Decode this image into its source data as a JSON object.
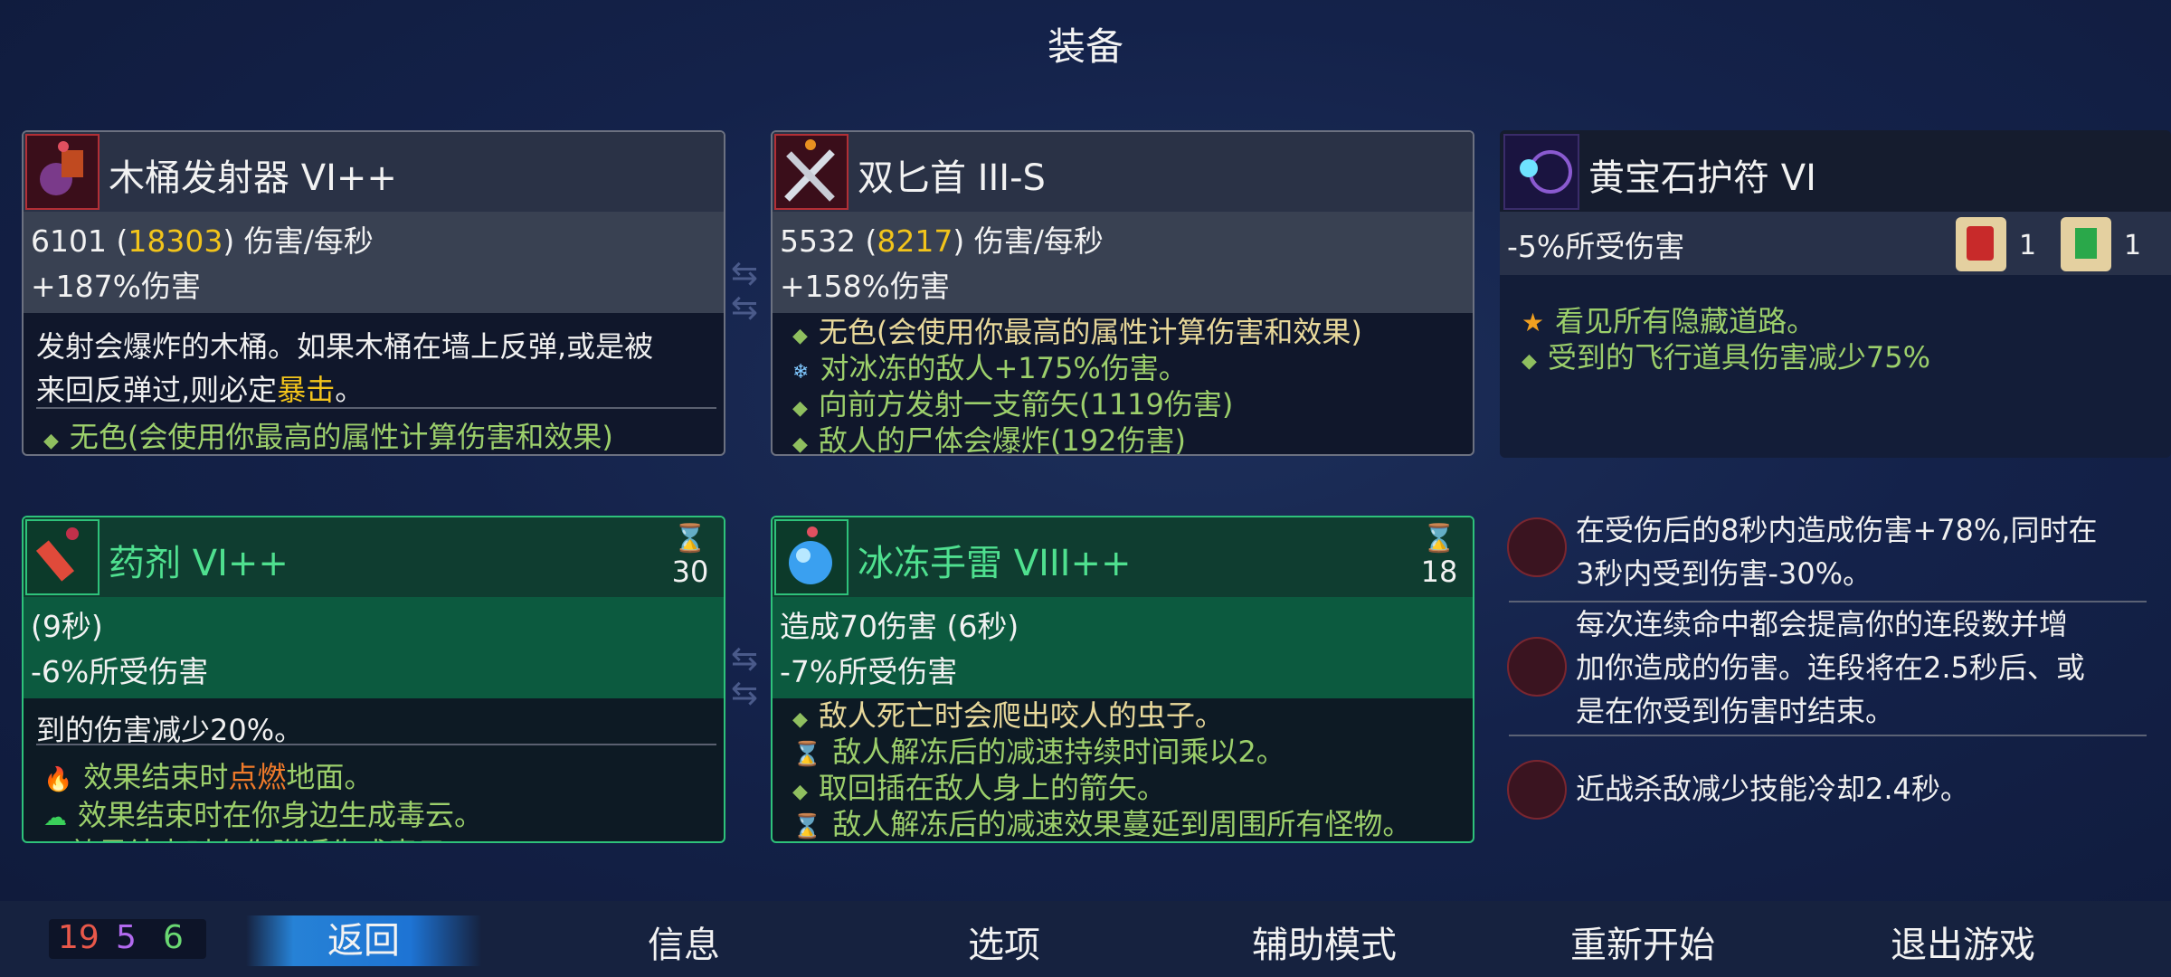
{
  "header": {
    "title": "装备"
  },
  "weapon1": {
    "name": "木桶发射器 VI++",
    "dps_base": "6101 (",
    "dps_crit": "18303",
    "dps_suffix": ") 伤害/每秒",
    "bonus": "+187%伤害",
    "desc1": "发射会爆炸的木桶。如果木桶在墙上反弹,或是被",
    "desc2a": "来回反弹过,则必定",
    "desc2b": "暴击",
    "desc2c": "。",
    "affix": "无色(会使用你最高的属性计算伤害和效果)"
  },
  "weapon2": {
    "name": "双匕首 III-S",
    "dps_base": "5532 (",
    "dps_crit": "8217",
    "dps_suffix": ") 伤害/每秒",
    "bonus": "+158%伤害",
    "lines": [
      "无色(会使用你最高的属性计算伤害和效果)",
      "对冰冻的敌人+175%伤害。",
      "向前方发射一支箭矢(1119伤害)",
      "敌人的尸体会爆炸(192伤害)"
    ]
  },
  "amulet": {
    "name": "黄宝石护符 VI",
    "stat": "-5%所受伤害",
    "scroll1_count": "1",
    "scroll2_count": "1",
    "lines": [
      "看见所有隐藏道路。",
      "受到的飞行道具伤害减少75%"
    ]
  },
  "skill1": {
    "name": "药剂 VI++",
    "cooldown": "30",
    "duration": "(9秒)",
    "stat": "-6%所受伤害",
    "line1": "到的伤害减少20%。",
    "line2a": "效果结束时",
    "line2b": "点燃",
    "line2c": "地面。",
    "line3": "效果结束时在你身边生成毒云。",
    "line4": "效果结束时在你附近生成毒云"
  },
  "skill2": {
    "name": "冰冻手雷 VIII++",
    "cooldown": "18",
    "damage": "造成70伤害 (6秒)",
    "stat": "-7%所受伤害",
    "lines": [
      "敌人死亡时会爬出咬人的虫子。",
      "敌人解冻后的减速持续时间乘以2。",
      "取回插在敌人身上的箭矢。",
      "敌人解冻后的减速效果蔓延到周围所有怪物。"
    ]
  },
  "mutations": [
    {
      "line1": "在受伤后的8秒内造成伤害+78%,同时在",
      "line2": "3秒内受到伤害-30%。"
    },
    {
      "line1": "每次连续命中都会提高你的连段数并增",
      "line2": "加你造成的伤害。连段将在2.5秒后、或",
      "line3": "是在你受到伤害时结束。"
    },
    {
      "line1": "近战杀敌减少技能冷却2.4秒。"
    }
  ],
  "stats": {
    "brutality": "19",
    "tactics": "5",
    "survival": "6"
  },
  "menu": {
    "back": "返回",
    "info": "信息",
    "options": "选项",
    "assist": "辅助模式",
    "restart": "重新开始",
    "quit": "退出游戏"
  },
  "colors": {
    "brutality": "#e8584a",
    "tactics": "#b26af0",
    "survival": "#6ad872",
    "crit": "#f2c41b",
    "freeze": "#7fc8ff",
    "burn": "#f07a2a"
  }
}
